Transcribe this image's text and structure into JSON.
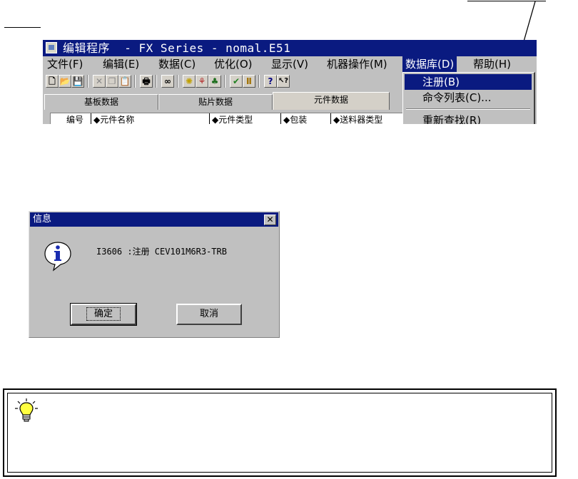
{
  "app": {
    "title": "编辑程序  - FX Series - nomal.E51",
    "menu": [
      {
        "label": "文件(F)",
        "active": false
      },
      {
        "label": "编辑(E)",
        "active": false
      },
      {
        "label": "数据(C)",
        "active": false
      },
      {
        "label": "优化(O)",
        "active": false
      },
      {
        "label": "显示(V)",
        "active": false
      },
      {
        "label": "机器操作(M)",
        "active": false
      },
      {
        "label": "数据库(D)",
        "active": true
      },
      {
        "label": "帮助(H)",
        "active": false
      }
    ],
    "toolbar": {
      "new_glyph": "🗋",
      "open_glyph": "📂",
      "save_glyph": "💾",
      "cut_glyph": "✕",
      "copy_glyph": "❐",
      "paste_glyph": "📋",
      "print_glyph": "🖶",
      "find_glyph": "∞",
      "bulb_glyph": "✺",
      "tree_glyph": "⚘",
      "group_glyph": "♣",
      "ok_glyph": "✔",
      "column_glyph": "Ⅱ",
      "help_glyph": "?",
      "pointer_help_glyph": "↖?"
    },
    "tabs": [
      {
        "label": "基板数据",
        "active": false
      },
      {
        "label": "贴片数据",
        "active": false
      },
      {
        "label": "元件数据",
        "active": true
      }
    ],
    "grid_headers": [
      "编号",
      "◆元件名称",
      "◆元件类型",
      "◆包装",
      "◆送料器类型"
    ],
    "dropdown": {
      "items": [
        {
          "label": "注册(B)",
          "highlighted": true
        },
        {
          "label": "命令列表(C)...",
          "highlighted": false
        },
        {
          "label": "重新查找(R)",
          "highlighted": false
        }
      ]
    }
  },
  "dialog": {
    "title": "信息",
    "close_glyph": "✕",
    "message": "I3606 :注册 CEV101M6R3-TRB",
    "ok_label": "确定",
    "cancel_label": "取消"
  },
  "colors": {
    "title_bar": "#0a1a80",
    "window_face": "#c0c0c0",
    "info_icon_blue": "#1a2cb0",
    "bulb_yellow": "#ffff40"
  },
  "icons": {
    "app_icon": "editor-app-icon",
    "dialog_icon": "info-icon",
    "tip_icon": "light-bulb-icon"
  }
}
